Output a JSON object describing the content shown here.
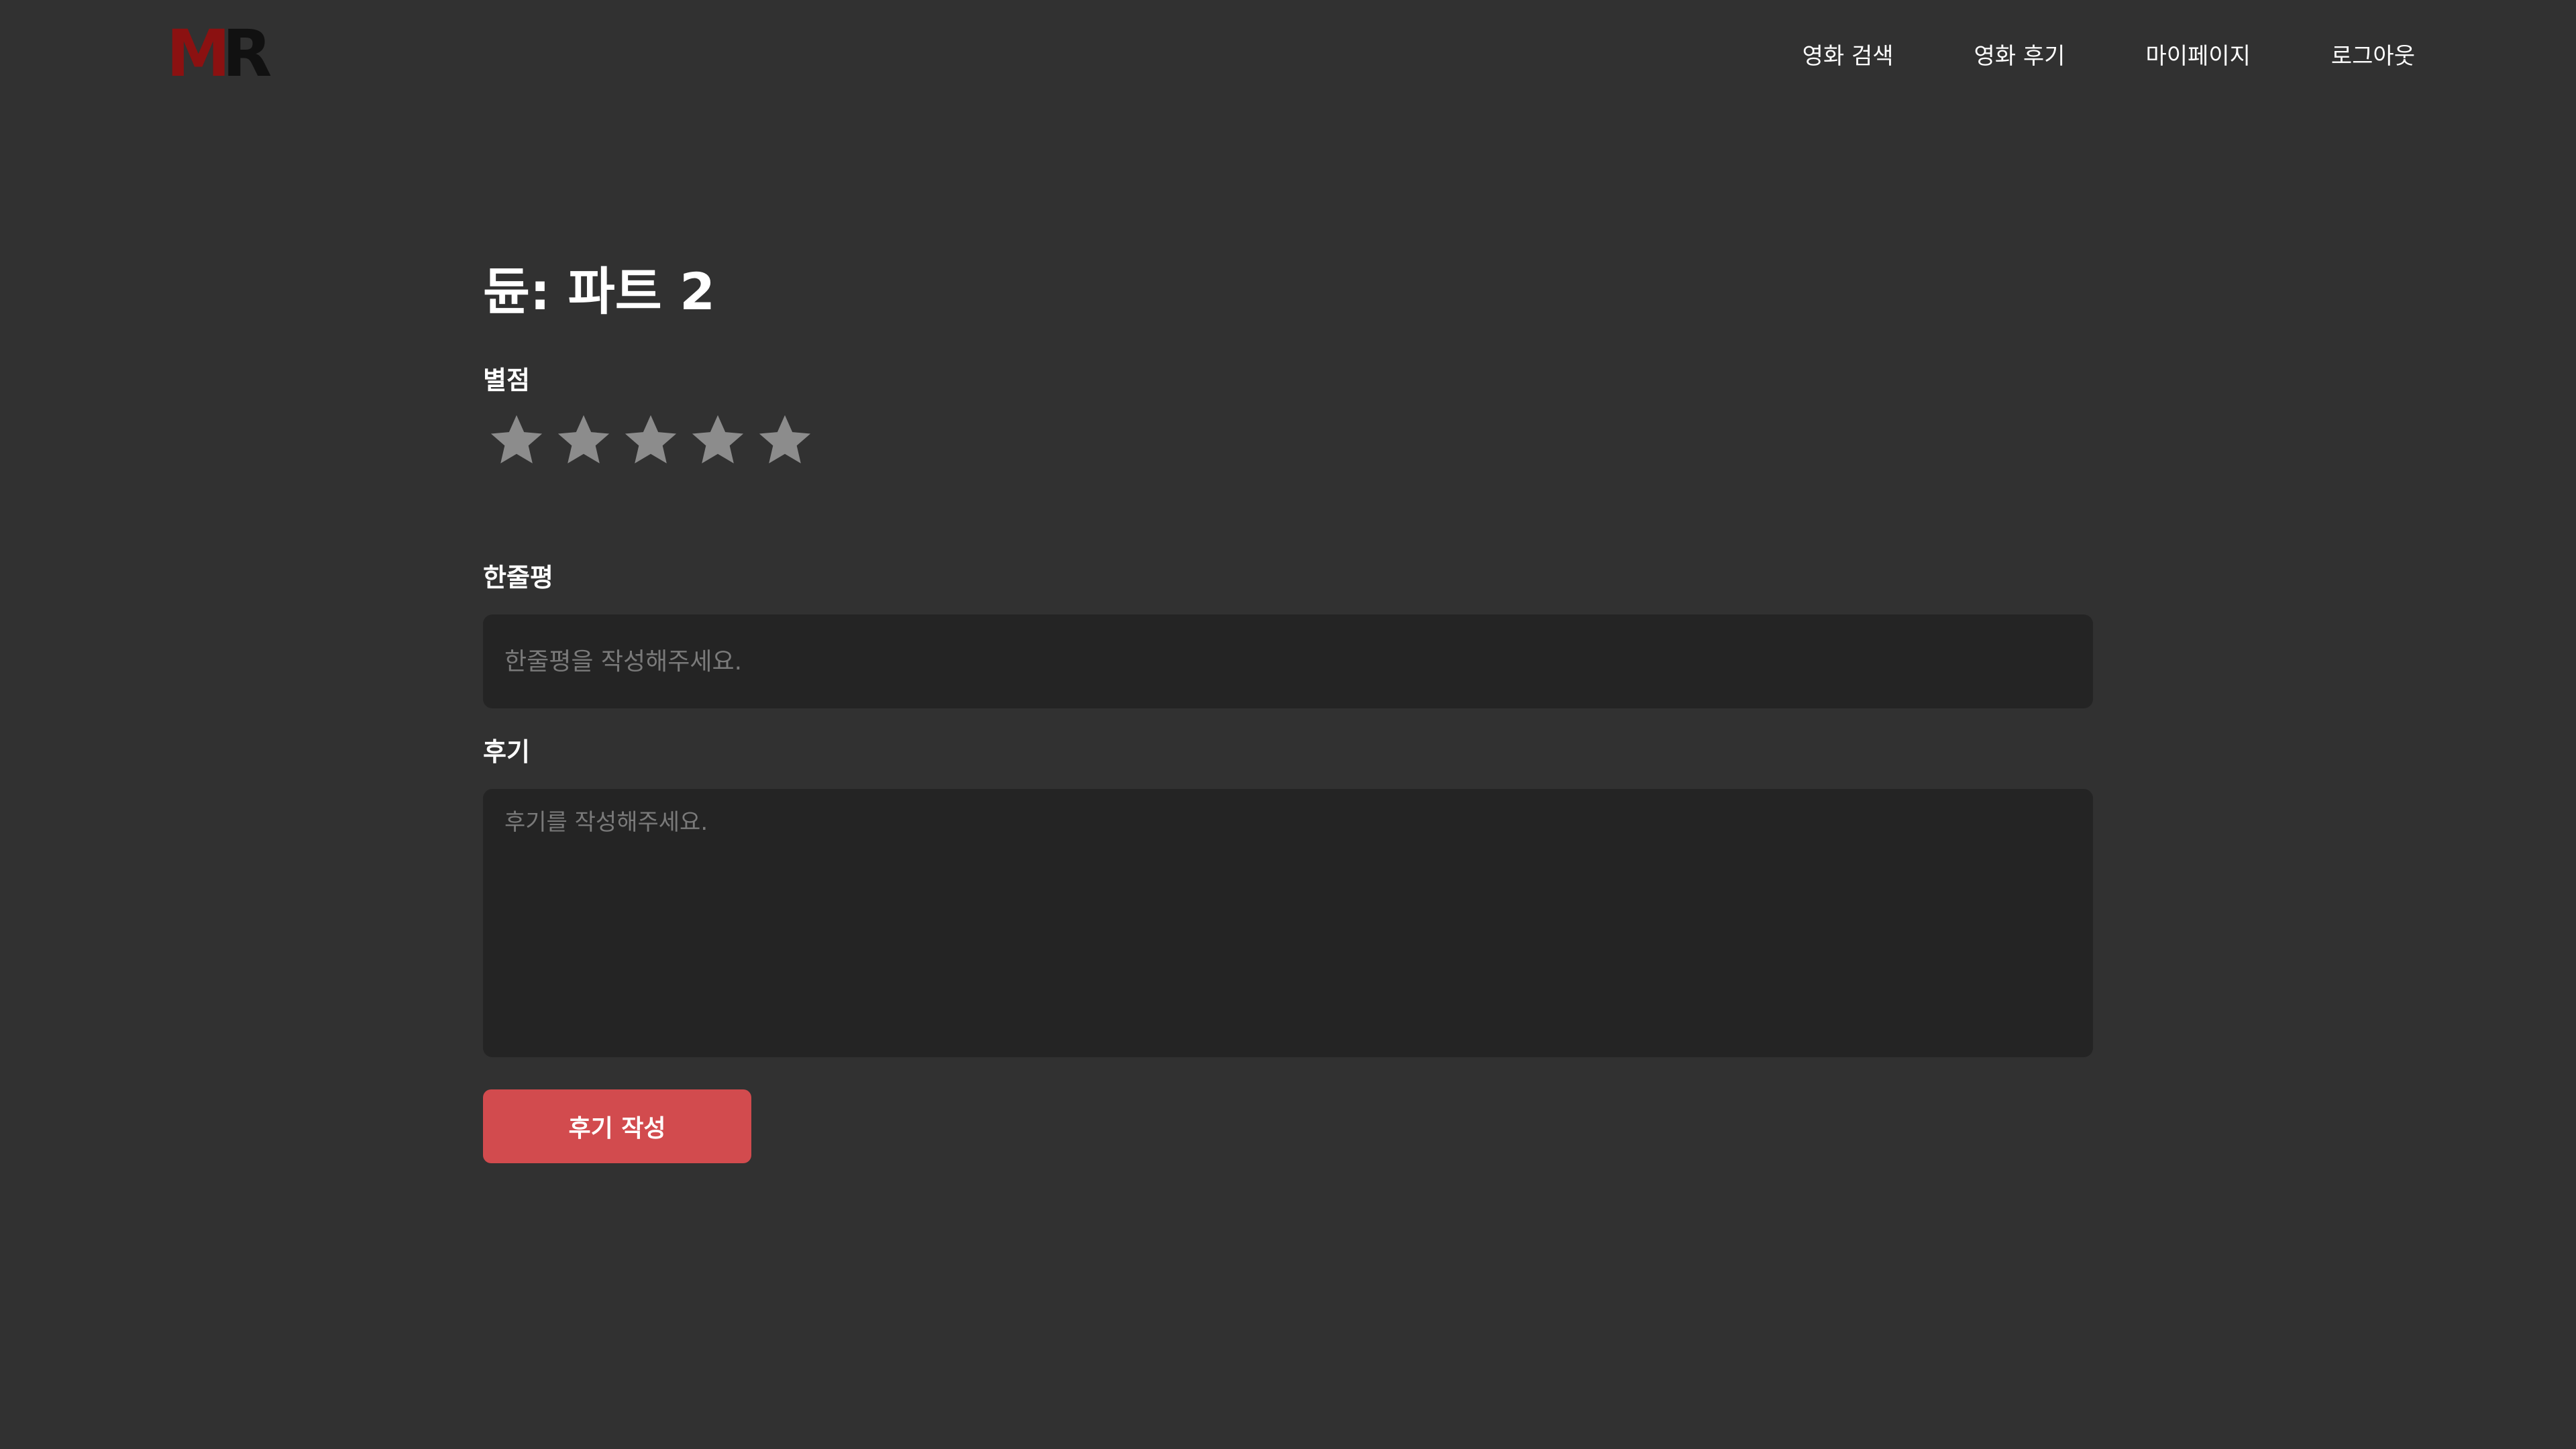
{
  "header": {
    "logo": {
      "letter_1": "M",
      "letter_2": "R",
      "color_1": "#8b1111",
      "color_2": "#111111"
    },
    "nav": [
      {
        "label": "영화 검색"
      },
      {
        "label": "영화 후기"
      },
      {
        "label": "마이페이지"
      },
      {
        "label": "로그아웃"
      }
    ]
  },
  "main": {
    "title": "듄: 파트 2",
    "rating": {
      "label": "별점",
      "icon": "star-icon",
      "max": 5,
      "value": 0,
      "empty_color": "#8c8c8c"
    },
    "one_line_review": {
      "label": "한줄평",
      "value": "",
      "placeholder": "한줄평을 작성해주세요."
    },
    "review": {
      "label": "후기",
      "value": "",
      "placeholder": "후기를 작성해주세요."
    },
    "submit_label": "후기 작성"
  },
  "colors": {
    "background": "#313131",
    "field_background": "#242424",
    "accent": "#d24b4e"
  }
}
